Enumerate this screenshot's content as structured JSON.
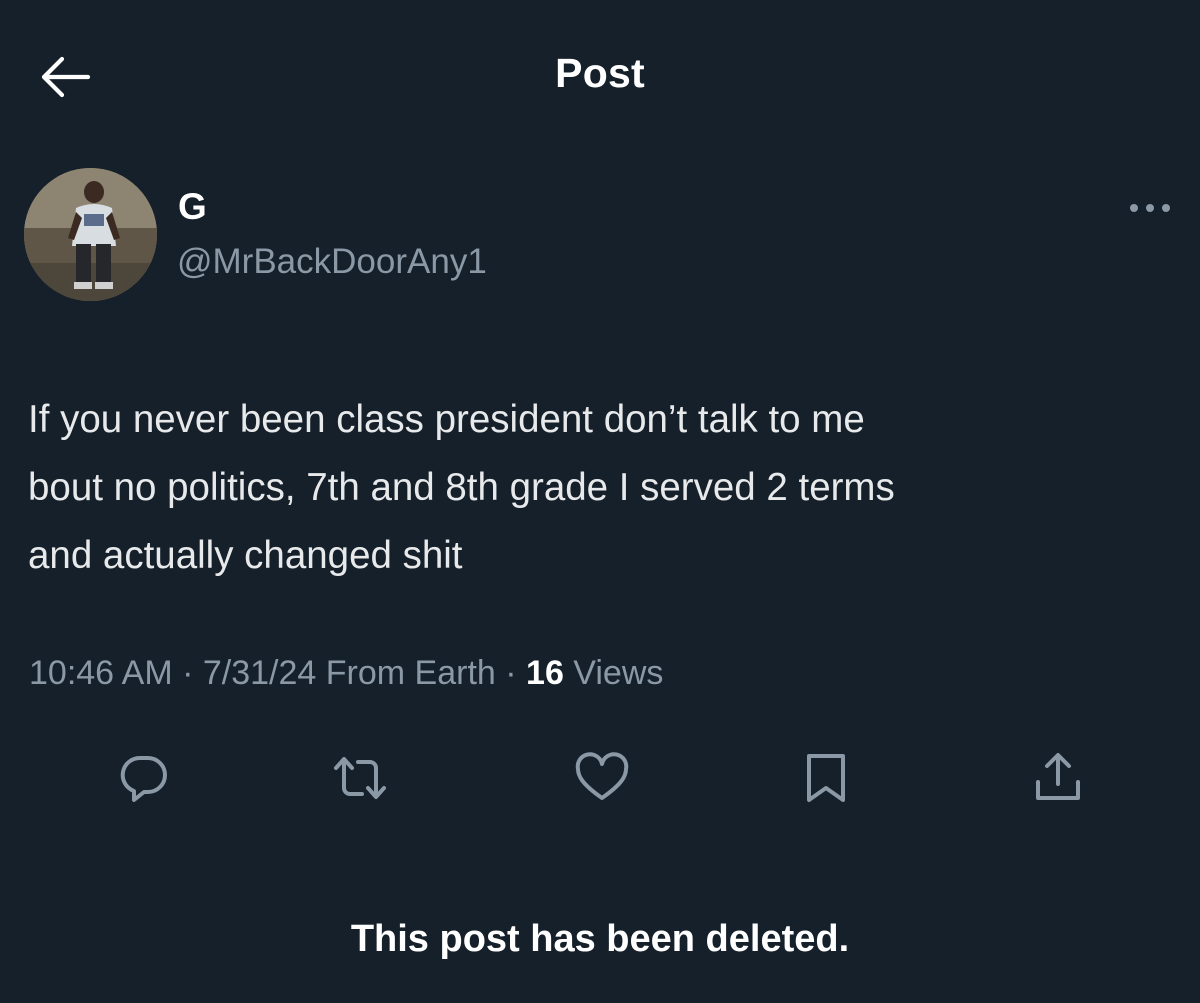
{
  "header": {
    "title": "Post",
    "back_icon": "arrow-left-icon"
  },
  "author": {
    "name": "G",
    "handle": "@MrBackDoorAny1",
    "avatar_icon": "profile-photo"
  },
  "post": {
    "text": "If you never been class president don’t talk to me\nbout no politics, 7th and 8th grade I served 2 terms\nand actually changed shit",
    "time": "10:46 AM",
    "separator_1": " · ",
    "date": "7/31/24",
    "source": " From Earth",
    "separator_2": " · ",
    "views_count": "16",
    "views_label": " Views"
  },
  "actions": [
    {
      "name": "reply",
      "icon": "reply-icon"
    },
    {
      "name": "repost",
      "icon": "repost-icon"
    },
    {
      "name": "like",
      "icon": "heart-icon"
    },
    {
      "name": "bookmark",
      "icon": "bookmark-icon"
    },
    {
      "name": "share",
      "icon": "share-icon"
    }
  ],
  "notice": {
    "text": "This post has been deleted."
  },
  "colors": {
    "background": "#15202b",
    "primary_text": "#e7e9ea",
    "secondary_text": "#8b98a5"
  }
}
